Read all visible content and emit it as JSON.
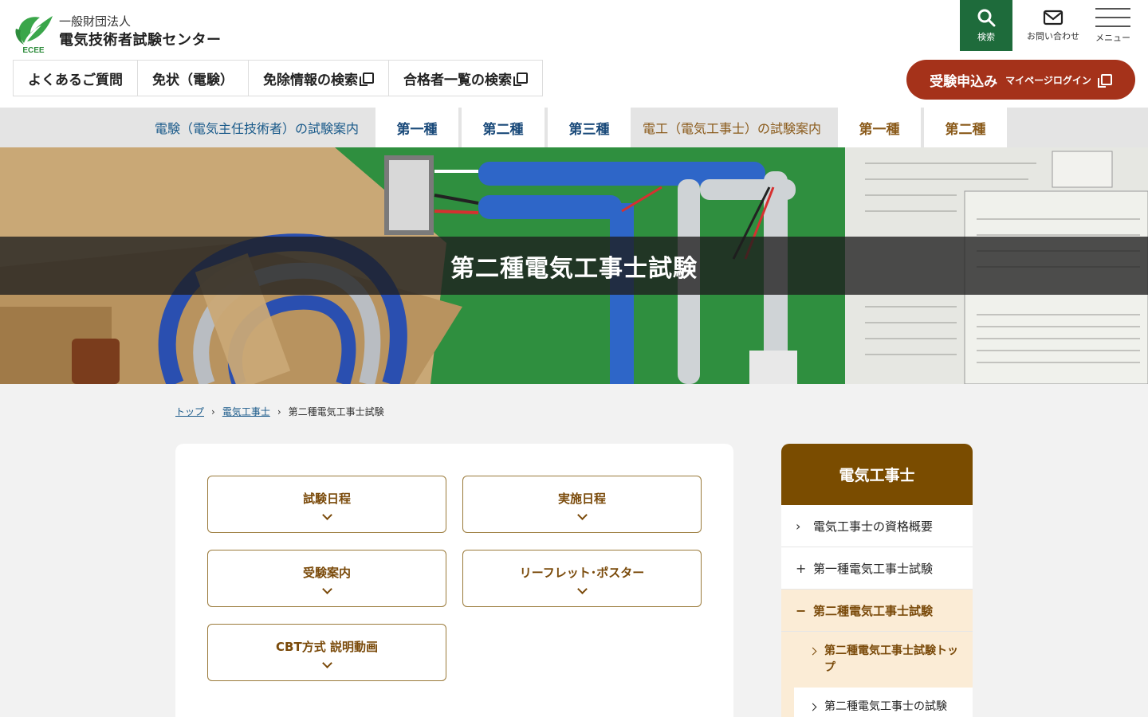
{
  "header": {
    "org_sub": "一般財団法人",
    "org_name": "電気技術者試験センター",
    "logo_letters": "ECEE",
    "search_label": "検索",
    "contact_label": "お問い合わせ",
    "menu_label": "メニュー"
  },
  "topnav": {
    "faq": "よくあるご質問",
    "license": "免状（電験）",
    "exemption": "免除情報の検索",
    "passers": "合格者一覧の検索"
  },
  "apply": {
    "main": "受験申込み",
    "sub": "マイページログイン"
  },
  "catbar": {
    "denken_label": "電験（電気主任技術者）の試験案内",
    "denken_tabs": [
      "第一種",
      "第二種",
      "第三種"
    ],
    "denko_label": "電工（電気工事士）の試験案内",
    "denko_tabs": [
      "第一種",
      "第二種"
    ]
  },
  "hero": {
    "title": "第二種電気工事士試験"
  },
  "breadcrumb": {
    "home": "トップ",
    "parent": "電気工事士",
    "current": "第二種電気工事士試験"
  },
  "links": [
    "試験日程",
    "実施日程",
    "受験案内",
    "リーフレット･ポスター",
    "CBT方式 説明動画"
  ],
  "sidebar": {
    "title": "電気工事士",
    "items": [
      {
        "mark": "›",
        "label": "電気工事士の資格概要"
      },
      {
        "mark": "+",
        "label": "第一種電気工事士試験"
      },
      {
        "mark": "−",
        "label": "第二種電気工事士試験"
      }
    ],
    "sub_items": [
      "第二種電気工事士試験トップ",
      "第二種電気工事士の試験"
    ]
  },
  "colors": {
    "brand_green": "#1e6b3b",
    "apply_red": "#a5321a",
    "sidebar_brown": "#7a4c00",
    "link_brown": "#7a4a0a"
  }
}
